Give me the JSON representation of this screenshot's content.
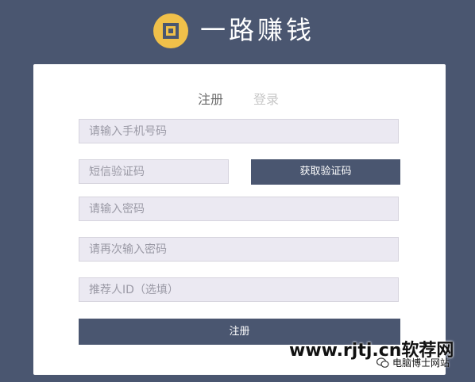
{
  "header": {
    "app_name": "一路赚钱",
    "logo_icon": "coin-square-hole-icon",
    "logo_color": "#f0c04a"
  },
  "tabs": [
    {
      "label": "注册",
      "active": true
    },
    {
      "label": "登录",
      "active": false
    }
  ],
  "form": {
    "phone_placeholder": "请输入手机号码",
    "sms_code_placeholder": "短信验证码",
    "get_code_label": "获取验证码",
    "password_placeholder": "请输入密码",
    "confirm_password_placeholder": "请再次输入密码",
    "referrer_placeholder": "推荐人ID（选填）",
    "submit_label": "注册"
  },
  "watermark": {
    "site": "www.rjtj.cn软荐网",
    "wechat_label": "电脑博士网站",
    "wechat_icon": "wechat-icon"
  },
  "colors": {
    "background": "#4a5670",
    "card": "#ffffff",
    "field_bg": "#ebe9f2",
    "button": "#4a5670"
  }
}
